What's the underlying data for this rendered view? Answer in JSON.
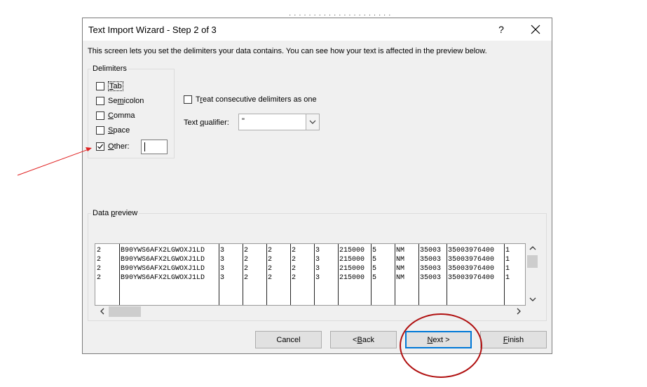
{
  "background": {
    "partial_text": "· · · · · · · · · ·  · · · · ·  · · · · · ·"
  },
  "dialog": {
    "title": "Text Import Wizard - Step 2 of 3",
    "help": "?",
    "intro": "This screen lets you set the delimiters your data contains.  You can see how your text is affected in the preview below."
  },
  "delimiters": {
    "legend": "Delimiters",
    "items": [
      {
        "pre": "",
        "u": "T",
        "post": "ab",
        "checked": false
      },
      {
        "pre": "Se",
        "u": "m",
        "post": "icolon",
        "checked": false
      },
      {
        "pre": "",
        "u": "C",
        "post": "omma",
        "checked": false
      },
      {
        "pre": "",
        "u": "S",
        "post": "pace",
        "checked": false
      },
      {
        "pre": "",
        "u": "O",
        "post": "ther:",
        "checked": true
      }
    ],
    "other_value": ""
  },
  "options": {
    "consecutive": {
      "pre": "T",
      "u": "r",
      "post": "eat consecutive delimiters as one",
      "checked": false
    },
    "qualifier_label": {
      "pre": "Text ",
      "u": "q",
      "post": "ualifier:"
    },
    "qualifier_value": "\""
  },
  "preview": {
    "legend_pre": "Data ",
    "legend_u": "p",
    "legend_post": "review",
    "rows": [
      [
        "2",
        "B90YWS6AFX2LGWOXJ1LD",
        "3",
        "2",
        "2",
        "2",
        "3",
        "215000",
        "5",
        "NM",
        "35003",
        "35003976400",
        "1"
      ],
      [
        "2",
        "B90YWS6AFX2LGWOXJ1LD",
        "3",
        "2",
        "2",
        "2",
        "3",
        "215000",
        "5",
        "NM",
        "35003",
        "35003976400",
        "1"
      ],
      [
        "2",
        "B90YWS6AFX2LGWOXJ1LD",
        "3",
        "2",
        "2",
        "2",
        "3",
        "215000",
        "5",
        "NM",
        "35003",
        "35003976400",
        "1"
      ],
      [
        "2",
        "B90YWS6AFX2LGWOXJ1LD",
        "3",
        "2",
        "2",
        "2",
        "3",
        "215000",
        "5",
        "NM",
        "35003",
        "35003976400",
        "1"
      ]
    ]
  },
  "buttons": {
    "cancel": "Cancel",
    "back_pre": "< ",
    "back_u": "B",
    "back_post": "ack",
    "next_u": "N",
    "next_post": "ext >",
    "finish_u": "F",
    "finish_post": "inish"
  },
  "colors": {
    "annotation": "#c00000",
    "arrow": "#e02020",
    "default_button_border": "#0078d7"
  }
}
